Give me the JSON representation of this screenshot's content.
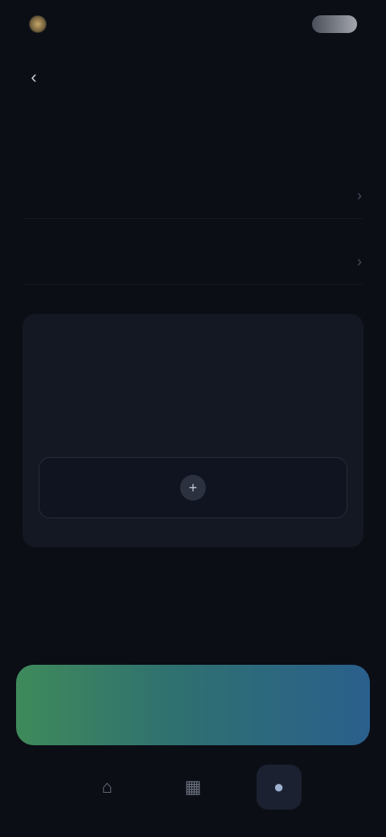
{
  "status_bar": {
    "left_text": "",
    "right_indicator": "battery-icon"
  },
  "header": {
    "title": "",
    "back_icon": "chevron-left-icon"
  },
  "section": {
    "label": ""
  },
  "rows": [
    {
      "label": "",
      "chevron": "chevron-right-icon"
    },
    {
      "label": "",
      "chevron": "chevron-right-icon"
    }
  ],
  "card": {
    "text": "",
    "action_icon": "plus-icon"
  },
  "primary_button": {
    "label": ""
  },
  "bottom_nav": {
    "items": [
      {
        "icon": "home-icon"
      },
      {
        "icon": "grid-icon"
      },
      {
        "icon": "profile-icon",
        "active": true
      }
    ]
  },
  "colors": {
    "background": "#0b0e15",
    "card": "#141822",
    "button_gradient_start": "#3f8a5b",
    "button_gradient_end": "#2a5f8c"
  }
}
